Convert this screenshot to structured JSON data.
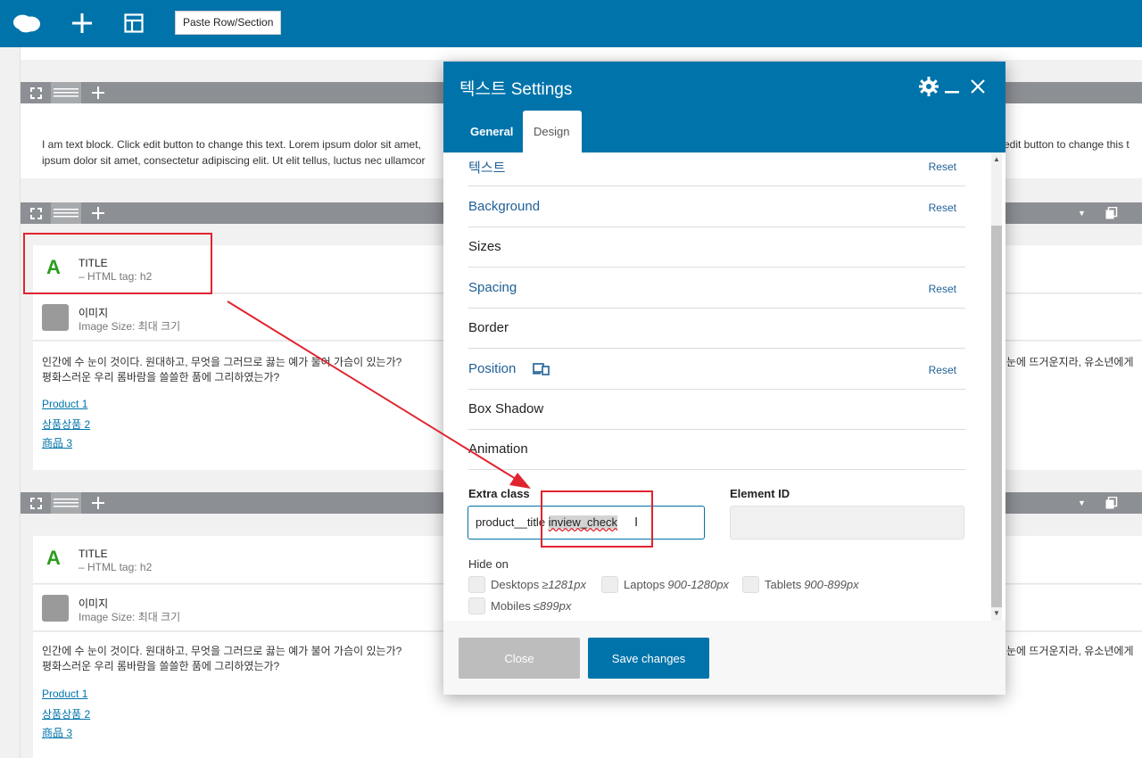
{
  "toolbar": {
    "paste_label": "Paste Row/Section"
  },
  "sections": {
    "text_block": "I am text block. Click edit button to change this text. Lorem ipsum dolor sit amet,",
    "text_block_line2": "ipsum dolor sit amet, consectetur adipiscing elit. Ut elit tellus, luctus nec ullamcor",
    "text_block_right": "edit button to change this t",
    "title_module": {
      "title": "TITLE",
      "sub": "– HTML tag: h2"
    },
    "image_module": {
      "title": "이미지",
      "sub": "Image Size: 최대 크기"
    },
    "paragraph_line1": "인간에 수 눈이 것이다. 원대하고, 무엇을 그러므로 끓는 예가 불어 가슴이 있는가?",
    "paragraph_line1_right": "눈에 뜨거운지라, 유소년에게",
    "paragraph_line2": "평화스러운 우리 롬바람을 쓸쓸한 품에 그리하였는가?",
    "links": [
      "Product 1",
      "상품상품 2",
      "商品 3"
    ]
  },
  "dialog": {
    "title": "텍스트 Settings",
    "tabs": [
      "General",
      "Design"
    ],
    "active_tab": "Design",
    "sections": [
      {
        "label": "텍스트",
        "reset": "Reset",
        "highlight": true
      },
      {
        "label": "Background",
        "reset": "Reset",
        "highlight": true
      },
      {
        "label": "Sizes",
        "reset": "",
        "highlight": false
      },
      {
        "label": "Spacing",
        "reset": "Reset",
        "highlight": true
      },
      {
        "label": "Border",
        "reset": "",
        "highlight": false
      },
      {
        "label": "Position",
        "reset": "Reset",
        "highlight": true
      },
      {
        "label": "Box Shadow",
        "reset": "",
        "highlight": false
      },
      {
        "label": "Animation",
        "reset": "",
        "highlight": false
      }
    ],
    "extra_class_label": "Extra class",
    "extra_class_value_part1": "product__title ",
    "extra_class_value_part2": "inview_check",
    "element_id_label": "Element ID",
    "element_id_value": "",
    "hide_on_label": "Hide on",
    "hide_on": [
      {
        "label": "Desktops",
        "range": "≥1281px"
      },
      {
        "label": "Laptops",
        "range": "900-1280px"
      },
      {
        "label": "Tablets",
        "range": "900-899px"
      },
      {
        "label": "Mobiles",
        "range": "≤899px"
      }
    ],
    "close_label": "Close",
    "save_label": "Save changes"
  },
  "colors": {
    "toolbar": "#0073aa",
    "row_bar": "#8c8f94",
    "section_blue": "#1e5f96",
    "annotation_red": "#e0242f",
    "title_icon": "#2a9d1f"
  }
}
